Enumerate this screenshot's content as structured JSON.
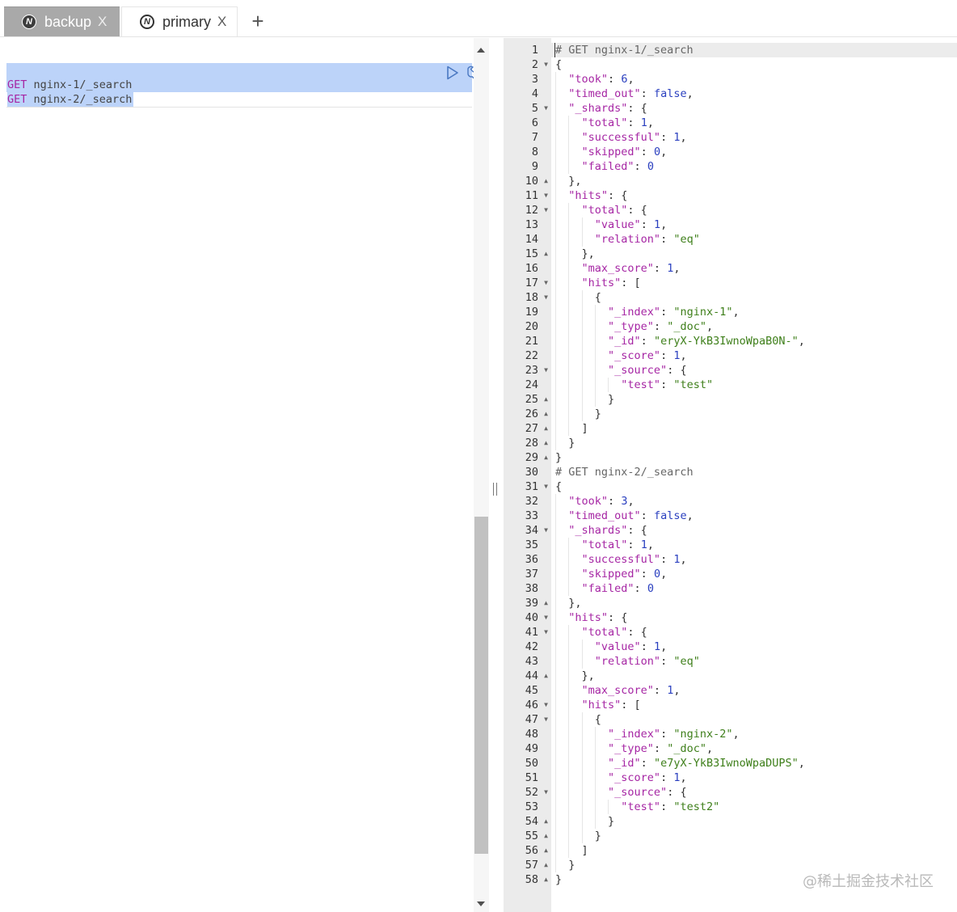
{
  "tabs": [
    {
      "label": "backup",
      "close": "X",
      "active": true
    },
    {
      "label": "primary",
      "close": "X",
      "active": false
    }
  ],
  "add_tab": "+",
  "editor": {
    "lines": [
      {
        "method": "GET",
        "path": " nginx-1/_search"
      },
      {
        "method": "GET",
        "path": " nginx-2/_search"
      }
    ]
  },
  "output": {
    "lines": [
      [
        [
          "cm",
          "# GET nginx-1/_search"
        ]
      ],
      [
        [
          "p",
          "{"
        ]
      ],
      [
        [
          "p",
          "  "
        ],
        [
          "k",
          "\"took\""
        ],
        [
          "p",
          ": "
        ],
        [
          "n",
          "6"
        ],
        [
          "p",
          ","
        ]
      ],
      [
        [
          "p",
          "  "
        ],
        [
          "k",
          "\"timed_out\""
        ],
        [
          "p",
          ": "
        ],
        [
          "b",
          "false"
        ],
        [
          "p",
          ","
        ]
      ],
      [
        [
          "p",
          "  "
        ],
        [
          "k",
          "\"_shards\""
        ],
        [
          "p",
          ": {"
        ]
      ],
      [
        [
          "p",
          "    "
        ],
        [
          "k",
          "\"total\""
        ],
        [
          "p",
          ": "
        ],
        [
          "n",
          "1"
        ],
        [
          "p",
          ","
        ]
      ],
      [
        [
          "p",
          "    "
        ],
        [
          "k",
          "\"successful\""
        ],
        [
          "p",
          ": "
        ],
        [
          "n",
          "1"
        ],
        [
          "p",
          ","
        ]
      ],
      [
        [
          "p",
          "    "
        ],
        [
          "k",
          "\"skipped\""
        ],
        [
          "p",
          ": "
        ],
        [
          "n",
          "0"
        ],
        [
          "p",
          ","
        ]
      ],
      [
        [
          "p",
          "    "
        ],
        [
          "k",
          "\"failed\""
        ],
        [
          "p",
          ": "
        ],
        [
          "n",
          "0"
        ]
      ],
      [
        [
          "p",
          "  },"
        ]
      ],
      [
        [
          "p",
          "  "
        ],
        [
          "k",
          "\"hits\""
        ],
        [
          "p",
          ": {"
        ]
      ],
      [
        [
          "p",
          "    "
        ],
        [
          "k",
          "\"total\""
        ],
        [
          "p",
          ": {"
        ]
      ],
      [
        [
          "p",
          "      "
        ],
        [
          "k",
          "\"value\""
        ],
        [
          "p",
          ": "
        ],
        [
          "n",
          "1"
        ],
        [
          "p",
          ","
        ]
      ],
      [
        [
          "p",
          "      "
        ],
        [
          "k",
          "\"relation\""
        ],
        [
          "p",
          ": "
        ],
        [
          "s",
          "\"eq\""
        ]
      ],
      [
        [
          "p",
          "    },"
        ]
      ],
      [
        [
          "p",
          "    "
        ],
        [
          "k",
          "\"max_score\""
        ],
        [
          "p",
          ": "
        ],
        [
          "n",
          "1"
        ],
        [
          "p",
          ","
        ]
      ],
      [
        [
          "p",
          "    "
        ],
        [
          "k",
          "\"hits\""
        ],
        [
          "p",
          ": ["
        ]
      ],
      [
        [
          "p",
          "      {"
        ]
      ],
      [
        [
          "p",
          "        "
        ],
        [
          "k",
          "\"_index\""
        ],
        [
          "p",
          ": "
        ],
        [
          "s",
          "\"nginx-1\""
        ],
        [
          "p",
          ","
        ]
      ],
      [
        [
          "p",
          "        "
        ],
        [
          "k",
          "\"_type\""
        ],
        [
          "p",
          ": "
        ],
        [
          "s",
          "\"_doc\""
        ],
        [
          "p",
          ","
        ]
      ],
      [
        [
          "p",
          "        "
        ],
        [
          "k",
          "\"_id\""
        ],
        [
          "p",
          ": "
        ],
        [
          "s",
          "\"eryX-YkB3IwnoWpaB0N-\""
        ],
        [
          "p",
          ","
        ]
      ],
      [
        [
          "p",
          "        "
        ],
        [
          "k",
          "\"_score\""
        ],
        [
          "p",
          ": "
        ],
        [
          "n",
          "1"
        ],
        [
          "p",
          ","
        ]
      ],
      [
        [
          "p",
          "        "
        ],
        [
          "k",
          "\"_source\""
        ],
        [
          "p",
          ": {"
        ]
      ],
      [
        [
          "p",
          "          "
        ],
        [
          "k",
          "\"test\""
        ],
        [
          "p",
          ": "
        ],
        [
          "s",
          "\"test\""
        ]
      ],
      [
        [
          "p",
          "        }"
        ]
      ],
      [
        [
          "p",
          "      }"
        ]
      ],
      [
        [
          "p",
          "    ]"
        ]
      ],
      [
        [
          "p",
          "  }"
        ]
      ],
      [
        [
          "p",
          "}"
        ]
      ],
      [
        [
          "cm",
          "# GET nginx-2/_search"
        ]
      ],
      [
        [
          "p",
          "{"
        ]
      ],
      [
        [
          "p",
          "  "
        ],
        [
          "k",
          "\"took\""
        ],
        [
          "p",
          ": "
        ],
        [
          "n",
          "3"
        ],
        [
          "p",
          ","
        ]
      ],
      [
        [
          "p",
          "  "
        ],
        [
          "k",
          "\"timed_out\""
        ],
        [
          "p",
          ": "
        ],
        [
          "b",
          "false"
        ],
        [
          "p",
          ","
        ]
      ],
      [
        [
          "p",
          "  "
        ],
        [
          "k",
          "\"_shards\""
        ],
        [
          "p",
          ": {"
        ]
      ],
      [
        [
          "p",
          "    "
        ],
        [
          "k",
          "\"total\""
        ],
        [
          "p",
          ": "
        ],
        [
          "n",
          "1"
        ],
        [
          "p",
          ","
        ]
      ],
      [
        [
          "p",
          "    "
        ],
        [
          "k",
          "\"successful\""
        ],
        [
          "p",
          ": "
        ],
        [
          "n",
          "1"
        ],
        [
          "p",
          ","
        ]
      ],
      [
        [
          "p",
          "    "
        ],
        [
          "k",
          "\"skipped\""
        ],
        [
          "p",
          ": "
        ],
        [
          "n",
          "0"
        ],
        [
          "p",
          ","
        ]
      ],
      [
        [
          "p",
          "    "
        ],
        [
          "k",
          "\"failed\""
        ],
        [
          "p",
          ": "
        ],
        [
          "n",
          "0"
        ]
      ],
      [
        [
          "p",
          "  },"
        ]
      ],
      [
        [
          "p",
          "  "
        ],
        [
          "k",
          "\"hits\""
        ],
        [
          "p",
          ": {"
        ]
      ],
      [
        [
          "p",
          "    "
        ],
        [
          "k",
          "\"total\""
        ],
        [
          "p",
          ": {"
        ]
      ],
      [
        [
          "p",
          "      "
        ],
        [
          "k",
          "\"value\""
        ],
        [
          "p",
          ": "
        ],
        [
          "n",
          "1"
        ],
        [
          "p",
          ","
        ]
      ],
      [
        [
          "p",
          "      "
        ],
        [
          "k",
          "\"relation\""
        ],
        [
          "p",
          ": "
        ],
        [
          "s",
          "\"eq\""
        ]
      ],
      [
        [
          "p",
          "    },"
        ]
      ],
      [
        [
          "p",
          "    "
        ],
        [
          "k",
          "\"max_score\""
        ],
        [
          "p",
          ": "
        ],
        [
          "n",
          "1"
        ],
        [
          "p",
          ","
        ]
      ],
      [
        [
          "p",
          "    "
        ],
        [
          "k",
          "\"hits\""
        ],
        [
          "p",
          ": ["
        ]
      ],
      [
        [
          "p",
          "      {"
        ]
      ],
      [
        [
          "p",
          "        "
        ],
        [
          "k",
          "\"_index\""
        ],
        [
          "p",
          ": "
        ],
        [
          "s",
          "\"nginx-2\""
        ],
        [
          "p",
          ","
        ]
      ],
      [
        [
          "p",
          "        "
        ],
        [
          "k",
          "\"_type\""
        ],
        [
          "p",
          ": "
        ],
        [
          "s",
          "\"_doc\""
        ],
        [
          "p",
          ","
        ]
      ],
      [
        [
          "p",
          "        "
        ],
        [
          "k",
          "\"_id\""
        ],
        [
          "p",
          ": "
        ],
        [
          "s",
          "\"e7yX-YkB3IwnoWpaDUPS\""
        ],
        [
          "p",
          ","
        ]
      ],
      [
        [
          "p",
          "        "
        ],
        [
          "k",
          "\"_score\""
        ],
        [
          "p",
          ": "
        ],
        [
          "n",
          "1"
        ],
        [
          "p",
          ","
        ]
      ],
      [
        [
          "p",
          "        "
        ],
        [
          "k",
          "\"_source\""
        ],
        [
          "p",
          ": {"
        ]
      ],
      [
        [
          "p",
          "          "
        ],
        [
          "k",
          "\"test\""
        ],
        [
          "p",
          ": "
        ],
        [
          "s",
          "\"test2\""
        ]
      ],
      [
        [
          "p",
          "        }"
        ]
      ],
      [
        [
          "p",
          "      }"
        ]
      ],
      [
        [
          "p",
          "    ]"
        ]
      ],
      [
        [
          "p",
          "  }"
        ]
      ],
      [
        [
          "p",
          "}"
        ]
      ]
    ],
    "fold_open": [
      2,
      5,
      11,
      12,
      17,
      18,
      23,
      31,
      34,
      40,
      41,
      46,
      47,
      52
    ],
    "fold_close": [
      10,
      15,
      25,
      26,
      27,
      28,
      29,
      39,
      44,
      54,
      55,
      56,
      57,
      58
    ]
  },
  "watermark": "@稀土掘金技术社区",
  "icons": {
    "tab_logo": "elasticsearch-head-icon",
    "run": "play-triangle-icon",
    "settings": "wrench-icon"
  },
  "colors": {
    "selection": "#bcd3f9",
    "active_tab": "#a9a9a9",
    "key": "#a626a4",
    "string": "#3e7f1a",
    "number": "#2a3fbf"
  }
}
